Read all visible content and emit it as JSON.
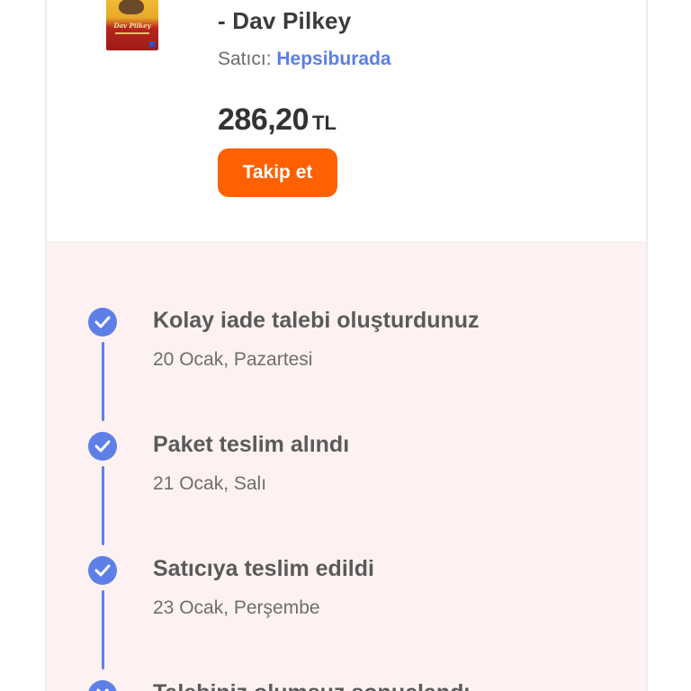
{
  "product": {
    "book_cover_text": "Dav Pilkey",
    "title_line": "- Dav Pilkey",
    "seller_label": "Satıcı:",
    "seller_name": "Hepsiburada",
    "price_amount": "286,20",
    "price_currency": "TL",
    "follow_button": "Takip et",
    "colors": {
      "accent_orange": "#ff6000",
      "seller_link": "#5b7ee6"
    }
  },
  "timeline": {
    "background": "#fdf2f1",
    "accent": "#5f7fe8",
    "steps": [
      {
        "title": "Kolay iade talebi oluşturdunuz",
        "date": "20 Ocak, Pazartesi",
        "icon": "check-circle-icon"
      },
      {
        "title": "Paket teslim alındı",
        "date": "21 Ocak, Salı",
        "icon": "check-circle-icon"
      },
      {
        "title": "Satıcıya teslim edildi",
        "date": "23 Ocak, Perşembe",
        "icon": "check-circle-icon"
      },
      {
        "title": "Talebiniz olumsuz sonuçlandı",
        "date": "",
        "icon": "close-circle-icon"
      }
    ]
  }
}
